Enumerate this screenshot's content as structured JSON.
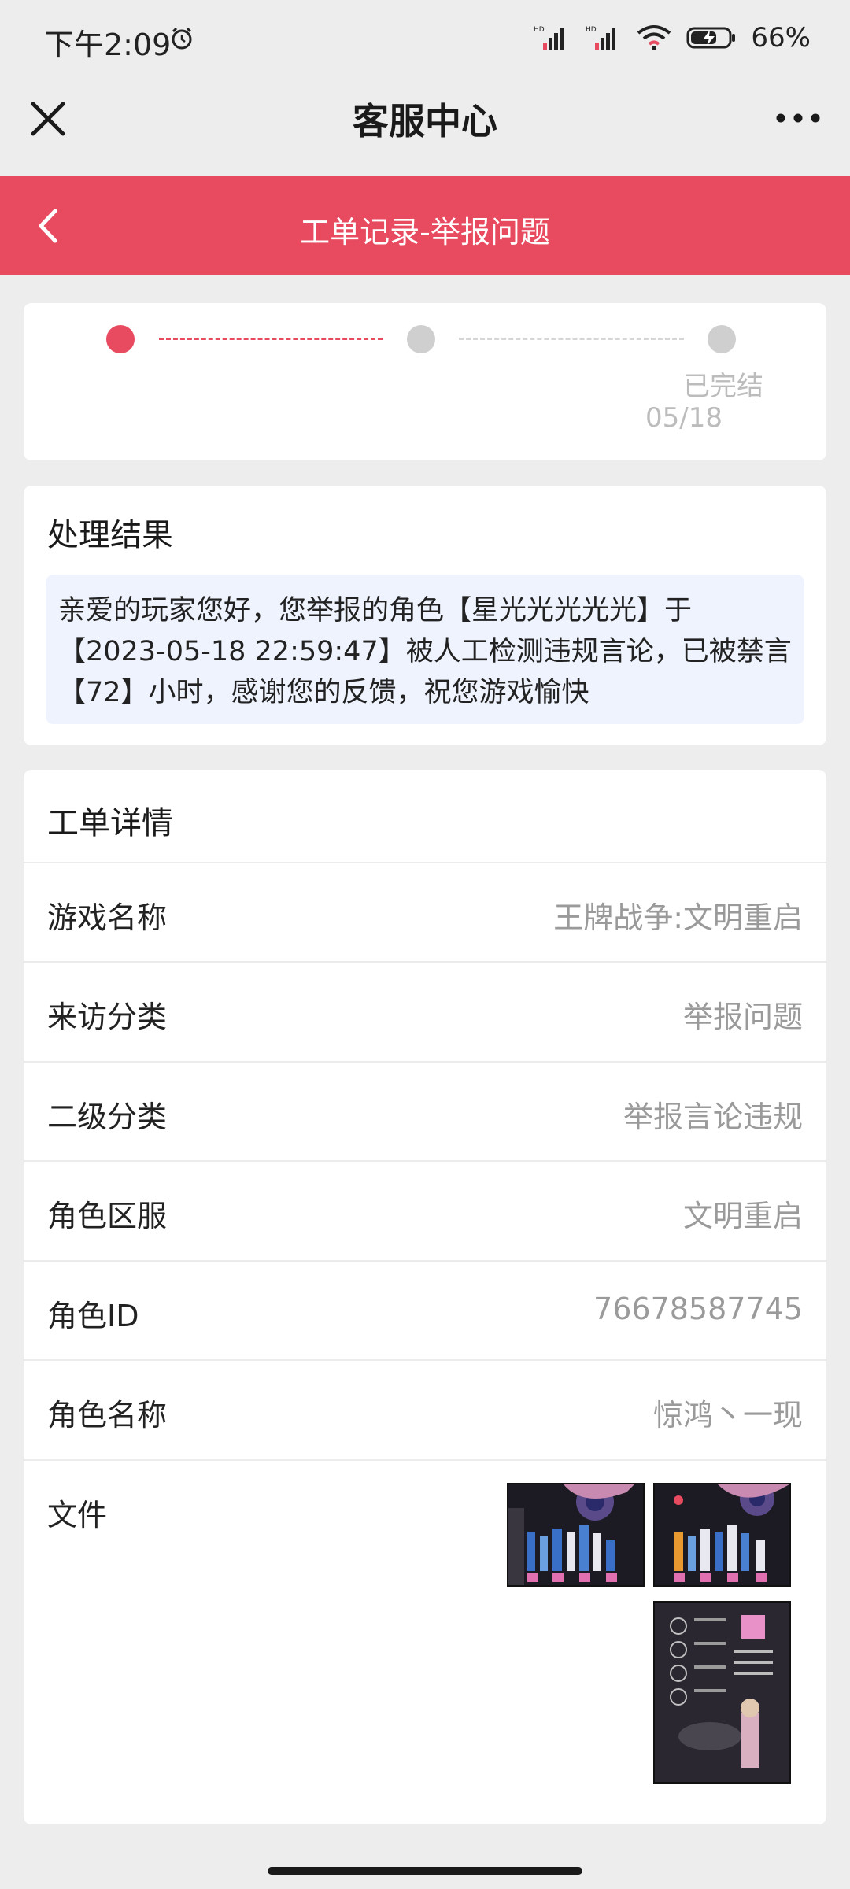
{
  "status_bar": {
    "time": "下午2:09",
    "battery": "66%"
  },
  "header": {
    "title": "客服中心"
  },
  "sub_header": {
    "title": "工单记录-举报问题"
  },
  "progress": {
    "steps": [
      {
        "state": "active",
        "color": "#e84a5f",
        "label": "",
        "date": ""
      },
      {
        "state": "pending",
        "color": "#cfcfcf",
        "label": "",
        "date": ""
      },
      {
        "state": "pending",
        "color": "#cfcfcf",
        "label": "已完结",
        "date": "05/18"
      }
    ]
  },
  "result": {
    "title": "处理结果",
    "text": "亲爱的玩家您好，您举报的角色【星光光光光光】于【2023-05-18 22:59:47】被人工检测违规言论，已被禁言【72】小时，感谢您的反馈，祝您游戏愉快"
  },
  "detail": {
    "title": "工单详情",
    "rows": [
      {
        "label": "游戏名称",
        "value": "王牌战争:文明重启"
      },
      {
        "label": "来访分类",
        "value": "举报问题"
      },
      {
        "label": "二级分类",
        "value": "举报言论违规"
      },
      {
        "label": "角色区服",
        "value": "文明重启"
      },
      {
        "label": "角色ID",
        "value": "76678587745"
      },
      {
        "label": "角色名称",
        "value": "惊鸿丶一现"
      }
    ],
    "file_label": "文件"
  },
  "colors": {
    "accent": "#e84a5f",
    "result_bg": "#eef3fe",
    "background": "#ededed"
  },
  "icons": [
    "alarm-icon",
    "signal-icon",
    "wifi-icon",
    "battery-icon",
    "close-icon",
    "more-icon",
    "back-icon"
  ]
}
